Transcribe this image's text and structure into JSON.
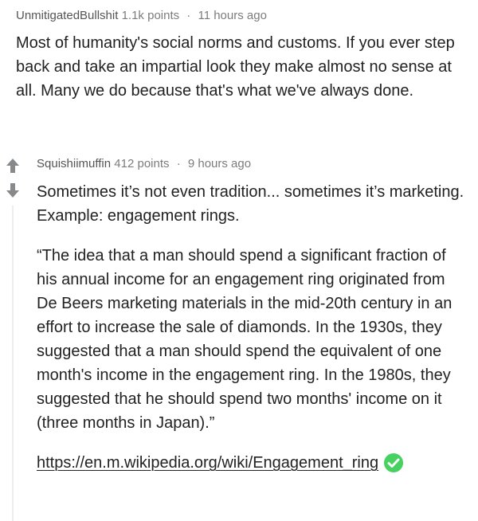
{
  "parent": {
    "author": "UnmitigatedBullshit",
    "points": "1.1k points",
    "separator": "·",
    "time": "11 hours ago",
    "body": "Most of humanity's social norms and customs. If you ever step back and take an impartial look they make almost no sense at all. Many we do because that's what we've always done."
  },
  "reply": {
    "author": "Squishiimuffin",
    "points": "412 points",
    "separator": "·",
    "time": "9 hours ago",
    "paragraph1": "Sometimes it’s not even tradition... sometimes it’s marketing. Example: engagement rings.",
    "quote": "“The idea that a man should spend a significant fraction of his annual income for an engagement ring originated from De Beers marketing materials in the mid-20th century in an effort to increase the sale of diamonds. In the 1930s, they suggested that a man should spend the equivalent of one month's income in the engagement ring. In the 1980s, they suggested that he should spend two months' income on it (three months in Japan).”",
    "link": "https://en.m.wikipedia.org/wiki/Engagement_ring"
  },
  "icons": {
    "upvote": "arrow-up-icon",
    "downvote": "arrow-down-icon",
    "verified": "check-circle-icon"
  },
  "colors": {
    "meta_text": "#7c7c7c",
    "body_text": "#222222",
    "vote_arrow": "#878a8c",
    "check_green": "#46d160",
    "thread_line": "#ededed"
  }
}
